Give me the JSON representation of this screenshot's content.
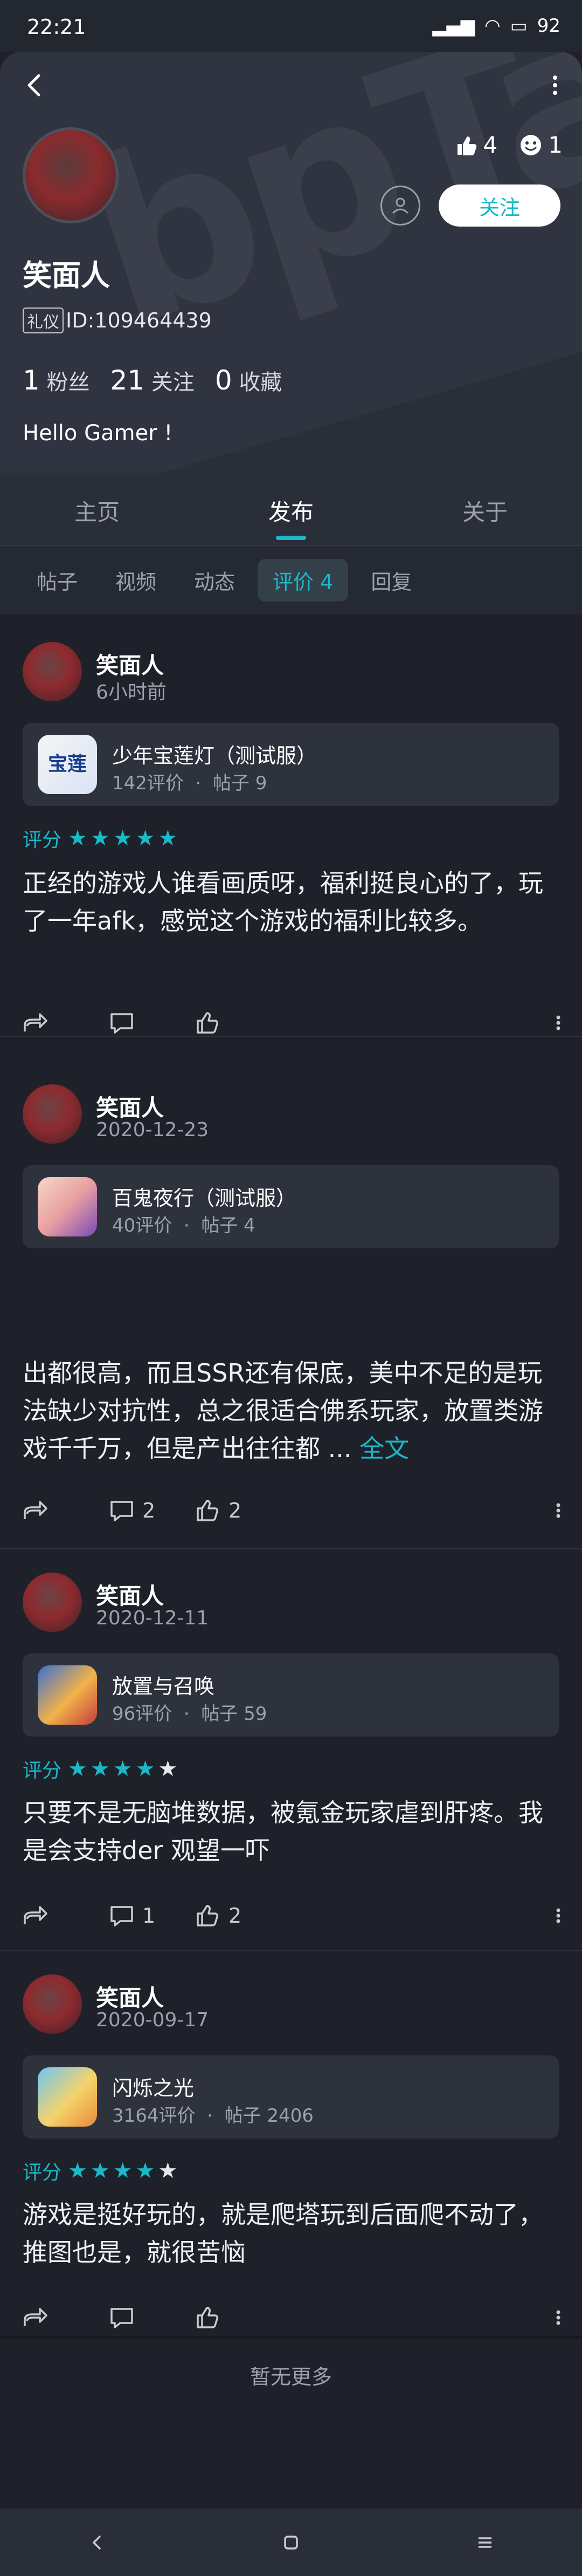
{
  "status_bar": {
    "time": "22:21",
    "battery": "92"
  },
  "header": {
    "watermark": "bpTa",
    "name": "笑面人",
    "tag": "礼仪",
    "id_text": "ID:109464439",
    "fans_count": "1",
    "fans_label": "粉丝",
    "following_count": "21",
    "following_label": "关注",
    "favorites_count": "0",
    "favorites_label": "收藏",
    "bio": "Hello Gamer !",
    "likes": "4",
    "smiles": "1",
    "follow_button": "关注"
  },
  "tabs": [
    "主页",
    "发布",
    "关于"
  ],
  "active_tab": 1,
  "subtabs": [
    "帖子",
    "视频",
    "动态",
    "评价 4",
    "回复"
  ],
  "posts": [
    {
      "author": "笑面人",
      "time": "6小时前",
      "game": {
        "name": "少年宝莲灯（测试服）",
        "reviews": "142评价",
        "posts": "帖子 9"
      },
      "rating_label": "评分",
      "stars": 5,
      "text": "正经的游戏人谁看画质呀，福利挺良心的了，玩了一年afk，感觉这个游戏的福利比较多。",
      "comments": "",
      "likes": ""
    },
    {
      "author": "笑面人",
      "time": "2020-12-23",
      "game": {
        "name": "百鬼夜行（测试服）",
        "reviews": "40评价",
        "posts": "帖子 4"
      },
      "text": "出都很高，而且SSR还有保底，美中不足的是玩法缺少对抗性，总之很适合佛系玩家，放置类游戏千千万，但是产出往往都 ...",
      "more": "全文",
      "comments": "2",
      "likes": "2"
    },
    {
      "author": "笑面人",
      "time": "2020-12-11",
      "game": {
        "name": "放置与召唤",
        "reviews": "96评价",
        "posts": "帖子 59"
      },
      "rating_label": "评分",
      "stars": 4,
      "text": "只要不是无脑堆数据，被氪金玩家虐到肝疼。我是会支持der 观望一吓",
      "comments": "1",
      "likes": "2"
    },
    {
      "author": "笑面人",
      "time": "2020-09-17",
      "game": {
        "name": "闪烁之光",
        "reviews": "3164评价",
        "posts": "帖子 2406"
      },
      "rating_label": "评分",
      "stars": 4,
      "text": "游戏是挺好玩的，就是爬塔玩到后面爬不动了，推图也是，就很苦恼",
      "comments": "",
      "likes": ""
    }
  ],
  "dot_separator": "·",
  "no_more": "暂无更多",
  "colors": {
    "accent": "#1ab8c8",
    "background": "#1e2129",
    "card": "#2d323c"
  }
}
